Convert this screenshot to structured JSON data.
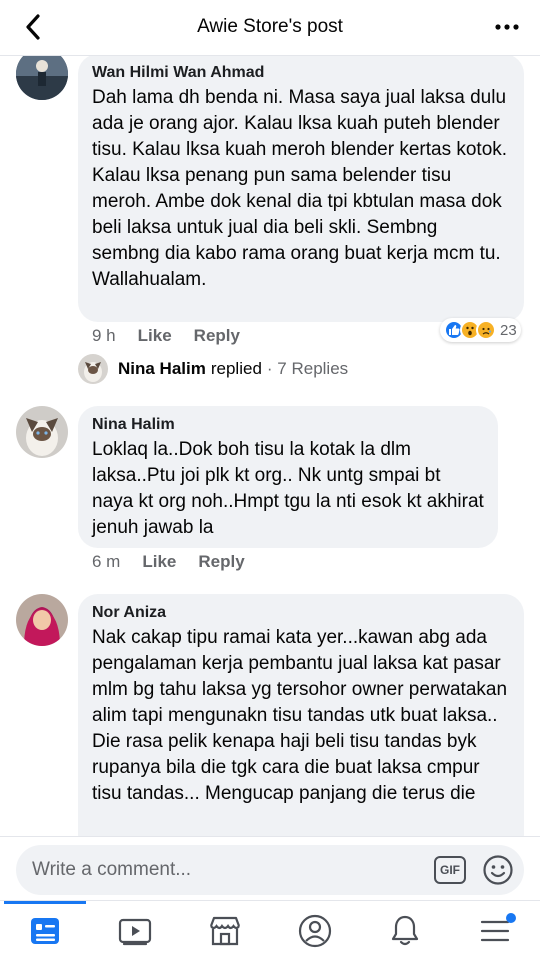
{
  "header": {
    "title": "Awie Store's post"
  },
  "comments": [
    {
      "author": "Wan Hilmi Wan Ahmad",
      "text": "Dah lama dh benda ni. Masa saya jual laksa dulu ada je orang ajor. Kalau lksa kuah puteh blender tisu. Kalau lksa kuah meroh blender kertas kotok. Kalau lksa penang pun sama belender tisu meroh. Ambe dok kenal dia tpi kbtulan masa dok beli laksa untuk jual dia beli skli. Sembng sembng dia kabo rama orang buat kerja mcm tu. Wallahualam.",
      "time": "9 h",
      "like_label": "Like",
      "reply_label": "Reply",
      "reaction_count": "23",
      "reactions": [
        "like",
        "wow",
        "sad"
      ],
      "reply_summary": {
        "author": "Nina Halim",
        "verb": "replied",
        "count": "· 7 Replies"
      }
    },
    {
      "author": "Nina Halim",
      "text": "Loklaq la..Dok boh tisu la kotak la dlm laksa..Ptu joi plk kt org.. Nk untg smpai bt naya kt org noh..Hmpt tgu la nti esok kt akhirat jenuh jawab la",
      "time": "6 m",
      "like_label": "Like",
      "reply_label": "Reply"
    },
    {
      "author": "Nor Aniza",
      "text": "Nak cakap tipu ramai kata yer...kawan abg ada pengalaman kerja pembantu jual laksa kat pasar mlm bg tahu laksa yg tersohor owner perwatakan alim tapi mengunakn tisu tandas utk buat laksa.. Die rasa pelik kenapa haji beli tisu tandas byk rupanya bila die tgk cara die buat laksa cmpur tisu tandas... Mengucap panjang die terus die"
    }
  ],
  "composer": {
    "placeholder": "Write a comment...",
    "gif_label": "GIF"
  },
  "bottom_nav": {
    "items": [
      "news-feed-icon",
      "watch-icon",
      "marketplace-icon",
      "profile-icon",
      "notifications-icon",
      "menu-icon"
    ],
    "active": "news-feed-icon",
    "accent": "#1877f2"
  }
}
